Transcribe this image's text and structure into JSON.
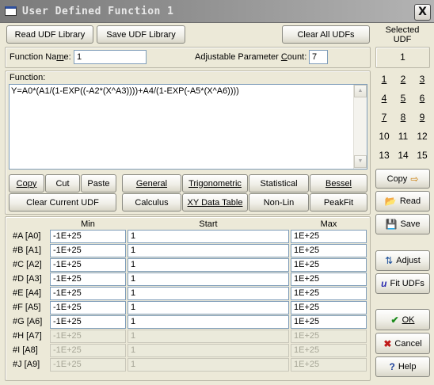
{
  "window": {
    "title": "User Defined Function 1",
    "close_glyph": "X"
  },
  "toolbar": {
    "read_udf_library": "Read UDF Library",
    "save_udf_library": "Save UDF Library",
    "clear_all_udfs": "Clear All UDFs",
    "selected_udf_label_line1": "Selected",
    "selected_udf_label_line2": "UDF",
    "selected_udf_value": "1"
  },
  "function_info": {
    "function_name_label": "Function Name:",
    "function_name_value": "1",
    "param_count_label": "Adjustable Parameter Count:",
    "param_count_value": "7"
  },
  "function": {
    "label": "Function:",
    "expression": "Y=A0*(A1/(1-EXP((-A2*(X^A3))))+A4/(1-EXP(-A5*(X^A6))))"
  },
  "number_pad": [
    "1",
    "2",
    "3",
    "4",
    "5",
    "6",
    "7",
    "8",
    "9",
    "10",
    "11",
    "12",
    "13",
    "14",
    "15"
  ],
  "edit_buttons": {
    "copy": "Copy",
    "cut": "Cut",
    "paste": "Paste",
    "clear_current_udf": "Clear Current UDF"
  },
  "category_buttons": {
    "general": "General",
    "trigonometric": "Trigonometric",
    "statistical": "Statistical",
    "bessel": "Bessel",
    "calculus": "Calculus",
    "xy_data_table": "XY Data Table",
    "non_lin": "Non-Lin",
    "peakfit": "PeakFit"
  },
  "side_buttons": {
    "copy": "Copy",
    "read": "Read",
    "save": "Save",
    "adjust": "Adjust",
    "fit_udfs": "Fit UDFs",
    "ok": "OK",
    "cancel": "Cancel",
    "help": "Help"
  },
  "params_table": {
    "headers": {
      "min": "Min",
      "start": "Start",
      "max": "Max"
    },
    "rows": [
      {
        "label": "#A [A0]",
        "min": "-1E+25",
        "start": "1",
        "max": "1E+25",
        "enabled": true
      },
      {
        "label": "#B [A1]",
        "min": "-1E+25",
        "start": "1",
        "max": "1E+25",
        "enabled": true
      },
      {
        "label": "#C [A2]",
        "min": "-1E+25",
        "start": "1",
        "max": "1E+25",
        "enabled": true
      },
      {
        "label": "#D [A3]",
        "min": "-1E+25",
        "start": "1",
        "max": "1E+25",
        "enabled": true
      },
      {
        "label": "#E [A4]",
        "min": "-1E+25",
        "start": "1",
        "max": "1E+25",
        "enabled": true
      },
      {
        "label": "#F [A5]",
        "min": "-1E+25",
        "start": "1",
        "max": "1E+25",
        "enabled": true
      },
      {
        "label": "#G [A6]",
        "min": "-1E+25",
        "start": "1",
        "max": "1E+25",
        "enabled": true
      },
      {
        "label": "#H [A7]",
        "min": "-1E+25",
        "start": "1",
        "max": "1E+25",
        "enabled": false
      },
      {
        "label": "#I [A8]",
        "min": "-1E+25",
        "start": "1",
        "max": "1E+25",
        "enabled": false
      },
      {
        "label": "#J [A9]",
        "min": "-1E+25",
        "start": "1",
        "max": "1E+25",
        "enabled": false
      }
    ]
  },
  "colors": {
    "window_bg": "#ece9d8",
    "titlebar": "#8e8e8e",
    "field_border": "#7f9db9",
    "disabled_text": "#a7a697"
  }
}
